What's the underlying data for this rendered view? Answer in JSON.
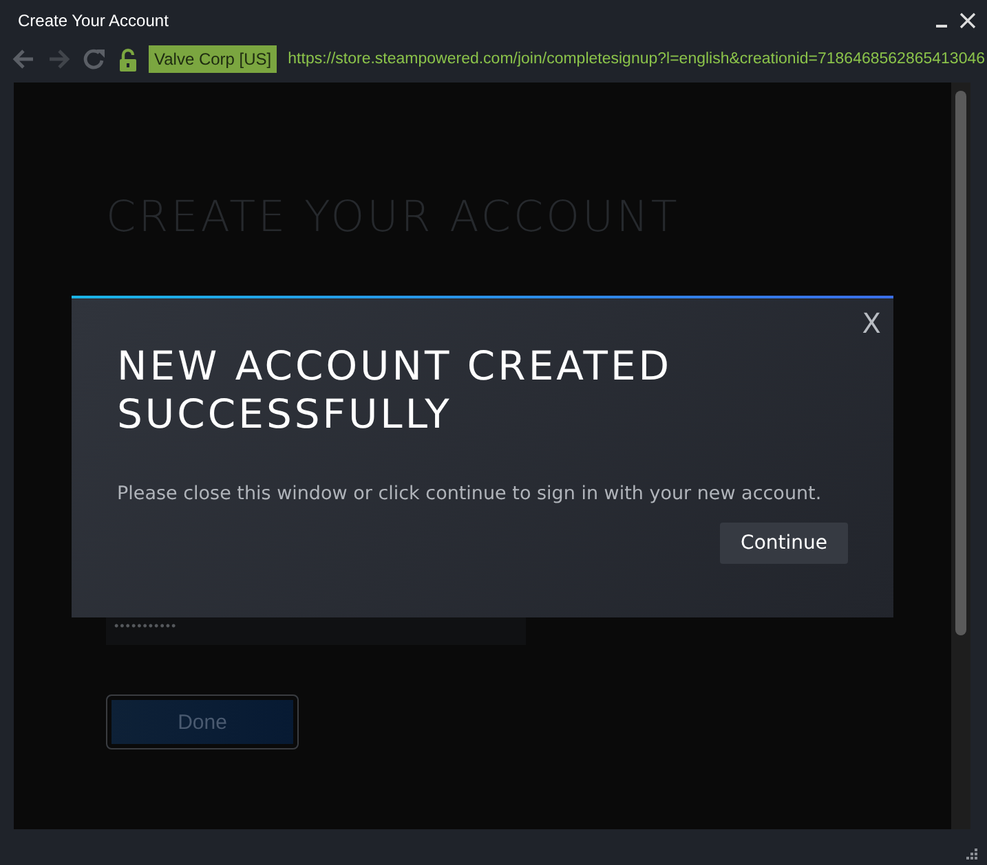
{
  "window": {
    "title": "Create Your Account"
  },
  "toolbar": {
    "certificate": "Valve Corp [US]",
    "url": "https://store.steampowered.com/join/completesignup?l=english&creationid=7186468562865413046"
  },
  "page": {
    "heading": "CREATE YOUR ACCOUNT",
    "password_field": {
      "value": "•••••••••••"
    },
    "done_button": "Done"
  },
  "dialog": {
    "title": "NEW ACCOUNT CREATED SUCCESSFULLY",
    "message": "Please close this window or click continue to sign in with your new account.",
    "close": "X",
    "button": "Continue"
  }
}
